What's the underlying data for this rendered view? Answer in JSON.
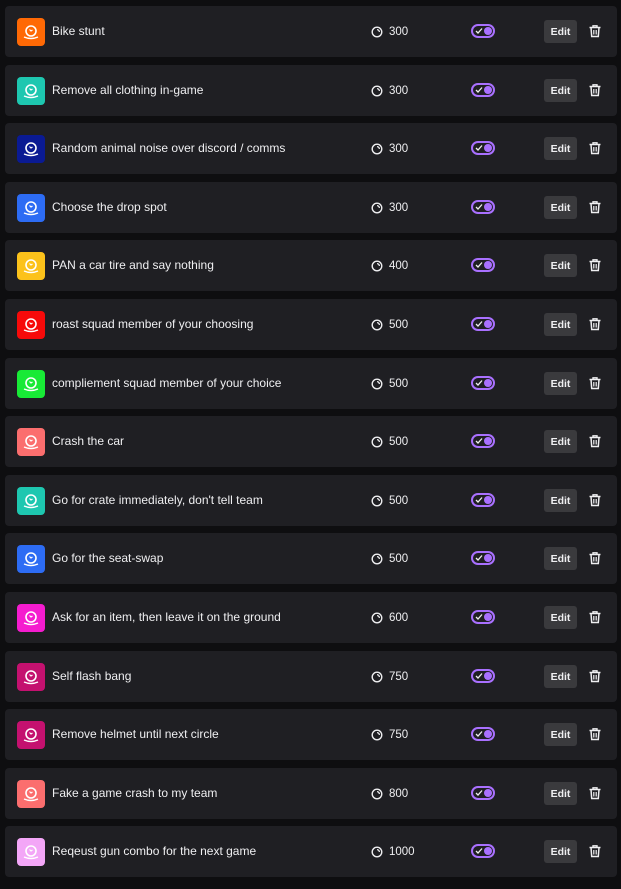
{
  "colors": {
    "accent": "#a970ff",
    "row_bg": "#1f1f23",
    "page_bg": "#0e0e10",
    "button_bg": "#3a3a3d"
  },
  "icons": {
    "reward": "reward-icon",
    "cost": "channel-points-icon",
    "toggle": "toggle-switch",
    "delete": "trash-icon"
  },
  "edit_label": "Edit",
  "rewards": [
    {
      "title": "Bike stunt",
      "cost": "300",
      "color": "#ff6905",
      "enabled": true
    },
    {
      "title": "Remove all clothing in-game",
      "cost": "300",
      "color": "#1ec7b0",
      "enabled": true
    },
    {
      "title": "Random animal noise over discord / comms",
      "cost": "300",
      "color": "#0a1a93",
      "enabled": true
    },
    {
      "title": "Choose the drop spot",
      "cost": "300",
      "color": "#2d6cf4",
      "enabled": true
    },
    {
      "title": "PAN a car tire and say nothing",
      "cost": "400",
      "color": "#fcc21b",
      "enabled": true
    },
    {
      "title": "roast squad member of your choosing",
      "cost": "500",
      "color": "#f70a0a",
      "enabled": true
    },
    {
      "title": "compliement squad member of your choice",
      "cost": "500",
      "color": "#18ea36",
      "enabled": true
    },
    {
      "title": "Crash the car",
      "cost": "500",
      "color": "#fb6e6e",
      "enabled": true
    },
    {
      "title": "Go for crate immediately, don't tell team",
      "cost": "500",
      "color": "#1ec7b0",
      "enabled": true
    },
    {
      "title": "Go for the seat-swap",
      "cost": "500",
      "color": "#2d6cf4",
      "enabled": true
    },
    {
      "title": "Ask for an item, then leave it on the ground",
      "cost": "600",
      "color": "#f51ccf",
      "enabled": true
    },
    {
      "title": "Self flash bang",
      "cost": "750",
      "color": "#c4116f",
      "enabled": true
    },
    {
      "title": "Remove helmet until next circle",
      "cost": "750",
      "color": "#c4116f",
      "enabled": true
    },
    {
      "title": "Fake a game crash to my team",
      "cost": "800",
      "color": "#fb6e6e",
      "enabled": true
    },
    {
      "title": "Reqeust gun combo for the next game",
      "cost": "1000",
      "color": "#f3a6f7",
      "enabled": true
    }
  ]
}
